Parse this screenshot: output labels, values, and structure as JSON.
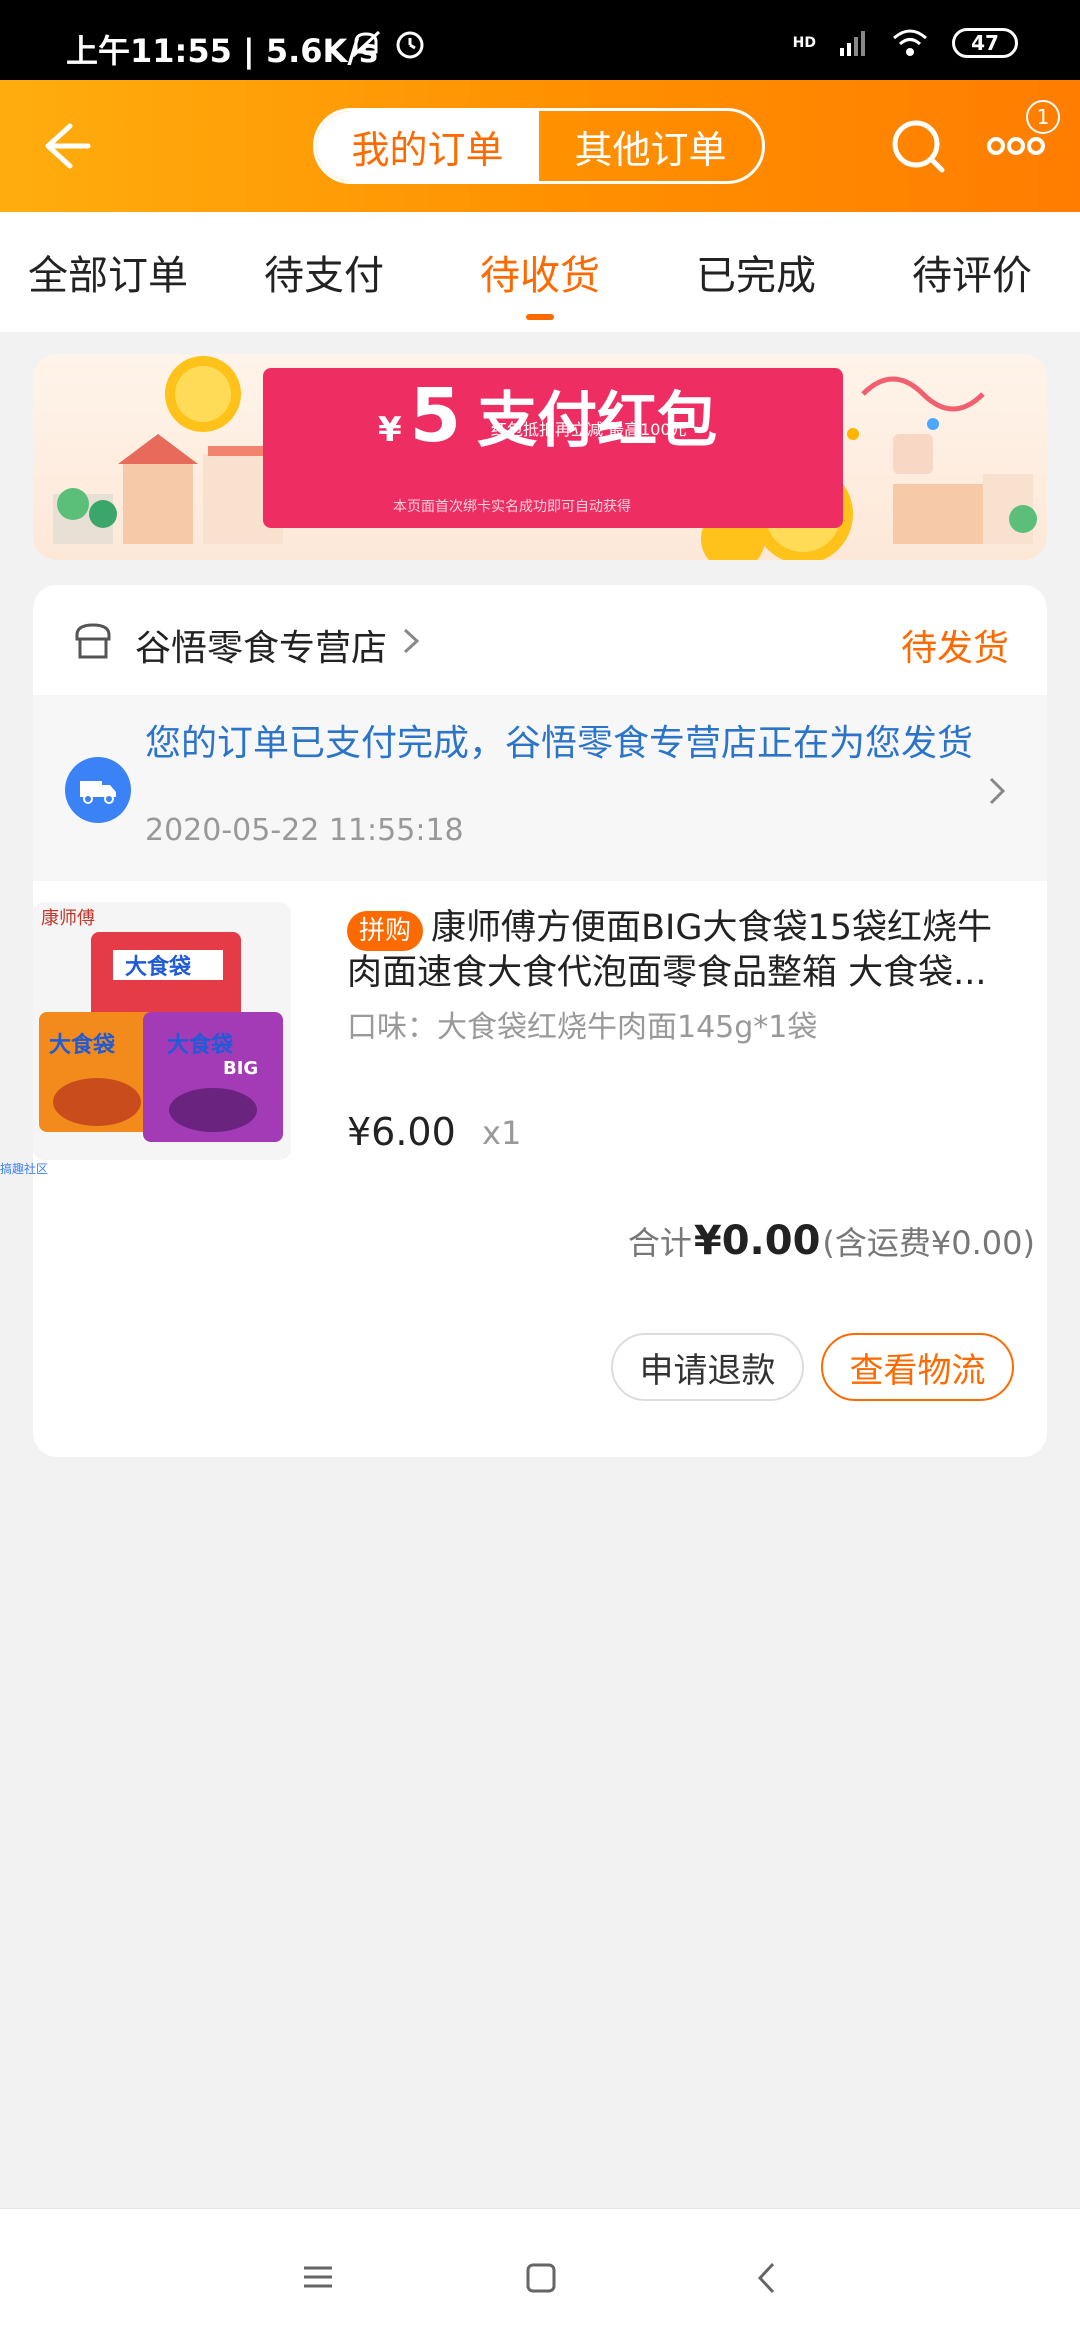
{
  "status_bar": {
    "time_and_speed": "上午11:55 | 5.6K/s",
    "network": "HD",
    "battery": "47",
    "icons": [
      "mute-icon",
      "alarm-icon",
      "signal-icon",
      "wifi-icon"
    ]
  },
  "header": {
    "segments": [
      {
        "label": "我的订单",
        "active": true
      },
      {
        "label": "其他订单",
        "active": false
      }
    ],
    "more_badge": "1",
    "brand_colors": {
      "accent": "#ff6a00",
      "header_start": "#ffad0e",
      "header_end": "#ff7d00"
    }
  },
  "tabs": [
    {
      "label": "全部订单",
      "active": false
    },
    {
      "label": "待支付",
      "active": false
    },
    {
      "label": "待收货",
      "active": true
    },
    {
      "label": "已完成",
      "active": false
    },
    {
      "label": "待评价",
      "active": false
    }
  ],
  "banner": {
    "currency": "¥",
    "amount": "5",
    "title": "支付红包",
    "sub": "红包抵扣再立减 最高100元",
    "note": "本页面首次绑卡实名成功即可自动获得"
  },
  "order": {
    "shop_name": "谷悟零食专营店",
    "status": "待发货",
    "notice": "您的订单已支付完成，谷悟零食专营店正在为您发货",
    "notice_time": "2020-05-22 11:55:18",
    "product": {
      "badge": "拼购",
      "title": "康师傅方便面BIG大食袋15袋红烧牛肉面速食大食代泡面零食品整箱 大食袋...",
      "spec": "口味：大食袋红烧牛肉面145g*1袋",
      "price": "¥6.00",
      "qty": "x1",
      "image_brand": "康师傅",
      "image_label": "大食袋",
      "image_sub": "BIG"
    },
    "total_label": "合计",
    "total_amount": "¥0.00",
    "shipping_note": "(含运费¥0.00)",
    "buttons": {
      "refund": "申请退款",
      "logistics": "查看物流"
    }
  },
  "watermark": "搞趣社区"
}
